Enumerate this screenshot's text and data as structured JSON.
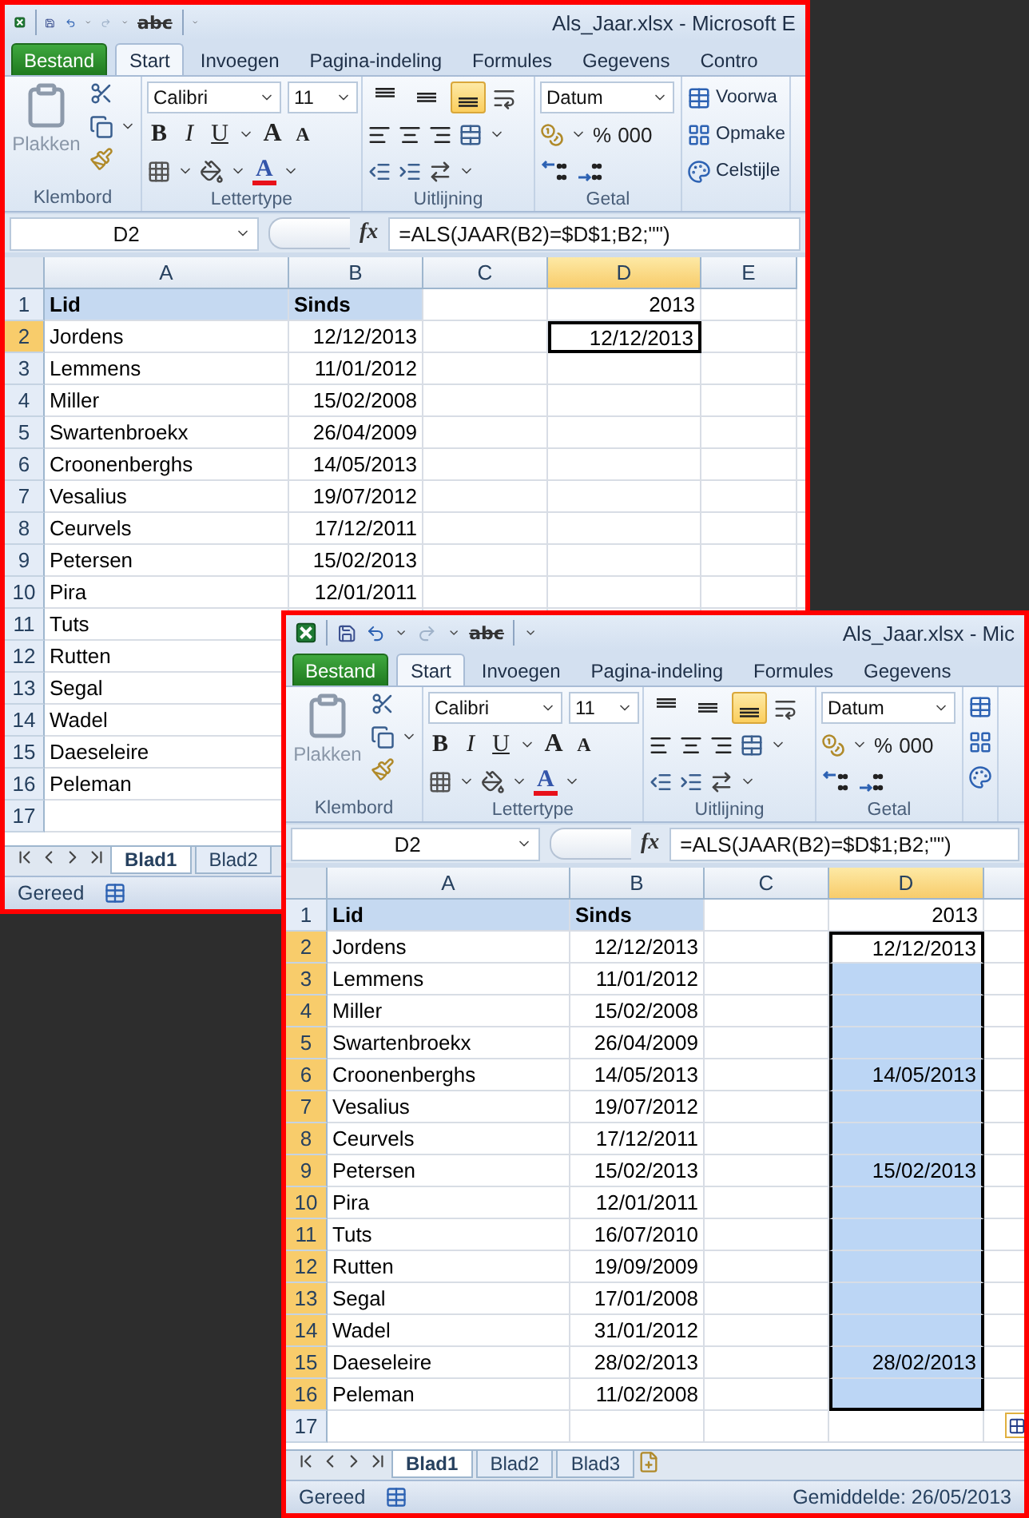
{
  "windows": [
    {
      "title": "Als_Jaar.xlsx  -  Microsoft E",
      "spell": "abc",
      "tabs": [
        {
          "label": "Bestand",
          "kind": "file",
          "selected": false
        },
        {
          "label": "Start",
          "kind": "tab",
          "selected": true
        },
        {
          "label": "Invoegen",
          "kind": "tab",
          "selected": false
        },
        {
          "label": "Pagina-indeling",
          "kind": "tab",
          "selected": false
        },
        {
          "label": "Formules",
          "kind": "tab",
          "selected": false
        },
        {
          "label": "Gegevens",
          "kind": "tab",
          "selected": false
        },
        {
          "label": "Contro",
          "kind": "tab",
          "selected": false
        }
      ],
      "ribbon": {
        "paste": "Plakken",
        "font": "Calibri",
        "size": "11",
        "font_buttons": [
          "B",
          "I",
          "U"
        ],
        "grow_shrink": [
          "A",
          "A"
        ],
        "font_color": "A",
        "alignment_buttons": [
          {
            "kind": "top",
            "selected": false
          },
          {
            "kind": "middle",
            "selected": false
          },
          {
            "kind": "bottom",
            "selected": true
          }
        ],
        "number_format": "Datum",
        "number_buttons": [
          "%",
          "000"
        ],
        "groups": [
          "Klembord",
          "Lettertype",
          "Uitlijning",
          "Getal"
        ],
        "styles": [
          "Voorwa",
          "Opmake",
          "Celstijle"
        ]
      },
      "name_box": "D2",
      "fx": "fx",
      "formula": "=ALS(JAAR(B2)=$D$1;B2;\"\")",
      "columns": [
        {
          "label": "A",
          "selected": false
        },
        {
          "label": "B",
          "selected": false
        },
        {
          "label": "C",
          "selected": false
        },
        {
          "label": "D",
          "selected": true
        },
        {
          "label": "E",
          "selected": false
        }
      ],
      "rows": [
        {
          "number": "1",
          "kind": "header",
          "selected": false,
          "a": "Lid",
          "b": "Sinds",
          "d": "2013",
          "d_selected": false,
          "d_active": false
        },
        {
          "number": "2",
          "kind": "data",
          "selected": true,
          "a": "Jordens",
          "b": "12/12/2013",
          "d": "12/12/2013",
          "d_selected": false,
          "d_active": true
        },
        {
          "number": "3",
          "kind": "data",
          "selected": false,
          "a": "Lemmens",
          "b": "11/01/2012",
          "d_selected": false,
          "d_active": false
        },
        {
          "number": "4",
          "kind": "data",
          "selected": false,
          "a": "Miller",
          "b": "15/02/2008",
          "d_selected": false,
          "d_active": false
        },
        {
          "number": "5",
          "kind": "data",
          "selected": false,
          "a": "Swartenbroekx",
          "b": "26/04/2009",
          "d_selected": false,
          "d_active": false
        },
        {
          "number": "6",
          "kind": "data",
          "selected": false,
          "a": "Croonenberghs",
          "b": "14/05/2013",
          "d_selected": false,
          "d_active": false
        },
        {
          "number": "7",
          "kind": "data",
          "selected": false,
          "a": "Vesalius",
          "b": "19/07/2012",
          "d_selected": false,
          "d_active": false
        },
        {
          "number": "8",
          "kind": "data",
          "selected": false,
          "a": "Ceurvels",
          "b": "17/12/2011",
          "d_selected": false,
          "d_active": false
        },
        {
          "number": "9",
          "kind": "data",
          "selected": false,
          "a": "Petersen",
          "b": "15/02/2013",
          "d_selected": false,
          "d_active": false
        },
        {
          "number": "10",
          "kind": "data",
          "selected": false,
          "a": "Pira",
          "b": "12/01/2011",
          "d_selected": false,
          "d_active": false
        },
        {
          "number": "11",
          "kind": "data",
          "selected": false,
          "a": "Tuts"
        },
        {
          "number": "12",
          "kind": "data",
          "selected": false,
          "a": "Rutten"
        },
        {
          "number": "13",
          "kind": "data",
          "selected": false,
          "a": "Segal"
        },
        {
          "number": "14",
          "kind": "data",
          "selected": false,
          "a": "Wadel"
        },
        {
          "number": "15",
          "kind": "data",
          "selected": false,
          "a": "Daeseleire"
        },
        {
          "number": "16",
          "kind": "data",
          "selected": false,
          "a": "Peleman"
        },
        {
          "number": "17",
          "kind": "data",
          "selected": false
        }
      ],
      "sheets": [
        {
          "label": "Blad1",
          "selected": true
        },
        {
          "label": "Blad2",
          "selected": false
        }
      ],
      "status": "Gereed"
    },
    {
      "title": "Als_Jaar.xlsx  -  Mic",
      "spell": "abc",
      "tabs": [
        {
          "label": "Bestand",
          "kind": "file",
          "selected": false
        },
        {
          "label": "Start",
          "kind": "tab",
          "selected": true
        },
        {
          "label": "Invoegen",
          "kind": "tab",
          "selected": false
        },
        {
          "label": "Pagina-indeling",
          "kind": "tab",
          "selected": false
        },
        {
          "label": "Formules",
          "kind": "tab",
          "selected": false
        },
        {
          "label": "Gegevens",
          "kind": "tab",
          "selected": false
        }
      ],
      "ribbon": {
        "paste": "Plakken",
        "font": "Calibri",
        "size": "11",
        "font_buttons": [
          "B",
          "I",
          "U"
        ],
        "grow_shrink": [
          "A",
          "A"
        ],
        "font_color": "A",
        "alignment_buttons": [
          {
            "kind": "top",
            "selected": false
          },
          {
            "kind": "middle",
            "selected": false
          },
          {
            "kind": "bottom",
            "selected": true
          }
        ],
        "number_format": "Datum",
        "number_buttons": [
          "%",
          "000"
        ],
        "groups": [
          "Klembord",
          "Lettertype",
          "Uitlijning",
          "Getal"
        ]
      },
      "name_box": "D2",
      "fx": "fx",
      "formula": "=ALS(JAAR(B2)=$D$1;B2;\"\")",
      "columns": [
        {
          "label": "A",
          "selected": false
        },
        {
          "label": "B",
          "selected": false
        },
        {
          "label": "C",
          "selected": false
        },
        {
          "label": "D",
          "selected": true
        }
      ],
      "rows": [
        {
          "number": "1",
          "kind": "header",
          "selected": false,
          "a": "Lid",
          "b": "Sinds",
          "d": "2013",
          "d_selected": false,
          "d_active": false
        },
        {
          "number": "2",
          "kind": "data",
          "selected": true,
          "a": "Jordens",
          "b": "12/12/2013",
          "d": "12/12/2013",
          "d_selected": true,
          "d_active": true
        },
        {
          "number": "3",
          "kind": "data",
          "selected": true,
          "a": "Lemmens",
          "b": "11/01/2012",
          "d_selected": true,
          "d_active": false
        },
        {
          "number": "4",
          "kind": "data",
          "selected": true,
          "a": "Miller",
          "b": "15/02/2008",
          "d_selected": true,
          "d_active": false
        },
        {
          "number": "5",
          "kind": "data",
          "selected": true,
          "a": "Swartenbroekx",
          "b": "26/04/2009",
          "d_selected": true,
          "d_active": false
        },
        {
          "number": "6",
          "kind": "data",
          "selected": true,
          "a": "Croonenberghs",
          "b": "14/05/2013",
          "d": "14/05/2013",
          "d_selected": true,
          "d_active": false
        },
        {
          "number": "7",
          "kind": "data",
          "selected": true,
          "a": "Vesalius",
          "b": "19/07/2012",
          "d_selected": true,
          "d_active": false
        },
        {
          "number": "8",
          "kind": "data",
          "selected": true,
          "a": "Ceurvels",
          "b": "17/12/2011",
          "d_selected": true,
          "d_active": false
        },
        {
          "number": "9",
          "kind": "data",
          "selected": true,
          "a": "Petersen",
          "b": "15/02/2013",
          "d": "15/02/2013",
          "d_selected": true,
          "d_active": false
        },
        {
          "number": "10",
          "kind": "data",
          "selected": true,
          "a": "Pira",
          "b": "12/01/2011",
          "d_selected": true,
          "d_active": false
        },
        {
          "number": "11",
          "kind": "data",
          "selected": true,
          "a": "Tuts",
          "b": "16/07/2010",
          "d_selected": true,
          "d_active": false
        },
        {
          "number": "12",
          "kind": "data",
          "selected": true,
          "a": "Rutten",
          "b": "19/09/2009",
          "d_selected": true,
          "d_active": false
        },
        {
          "number": "13",
          "kind": "data",
          "selected": true,
          "a": "Segal",
          "b": "17/01/2008",
          "d_selected": true,
          "d_active": false
        },
        {
          "number": "14",
          "kind": "data",
          "selected": true,
          "a": "Wadel",
          "b": "31/01/2012",
          "d_selected": true,
          "d_active": false
        },
        {
          "number": "15",
          "kind": "data",
          "selected": true,
          "a": "Daeseleire",
          "b": "28/02/2013",
          "d": "28/02/2013",
          "d_selected": true,
          "d_active": false
        },
        {
          "number": "16",
          "kind": "data",
          "selected": true,
          "a": "Peleman",
          "b": "11/02/2008",
          "d_selected": true,
          "d_active": false
        },
        {
          "number": "17",
          "kind": "data",
          "selected": false,
          "d_selected": false,
          "d_active": false
        }
      ],
      "sheets": [
        {
          "label": "Blad1",
          "selected": true
        },
        {
          "label": "Blad2",
          "selected": false
        },
        {
          "label": "Blad3",
          "selected": false
        }
      ],
      "status": "Gereed",
      "status_right": "Gemiddelde: 26/05/2013",
      "autofill_options": true
    }
  ]
}
